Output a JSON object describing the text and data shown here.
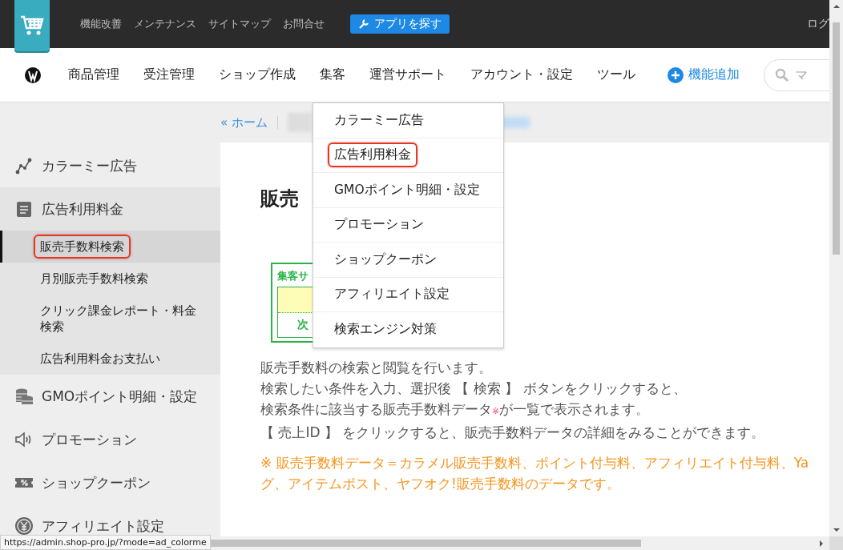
{
  "top_bar": {
    "links": [
      "機能改善",
      "メンテナンス",
      "サイトマップ",
      "お問合せ"
    ],
    "app_button": "アプリを探す",
    "login": "ログ"
  },
  "nav": {
    "items": [
      "商品管理",
      "受注管理",
      "ショップ作成",
      "集客",
      "運営サポート",
      "アカウント・設定",
      "ツール"
    ],
    "add_button": "機能追加",
    "search": {
      "placeholder": "マ"
    }
  },
  "breadcrumb": {
    "home": "« ホーム"
  },
  "sidebar": {
    "items": [
      {
        "label": "カラーミー広告",
        "kind": "chart"
      },
      {
        "label": "広告利用料金",
        "kind": "notepad",
        "children": [
          {
            "label": "販売手数料検索",
            "selected": true,
            "highlighted": true
          },
          {
            "label": "月別販売手数料検索",
            "selected": false,
            "highlighted": false
          },
          {
            "label": "クリック課金レポート・料金検索",
            "selected": false,
            "highlighted": false
          },
          {
            "label": "広告利用料金お支払い",
            "selected": false,
            "highlighted": false
          }
        ]
      },
      {
        "label": "GMOポイント明細・設定",
        "kind": "coins"
      },
      {
        "label": "プロモーション",
        "kind": "speaker"
      },
      {
        "label": "ショップクーポン",
        "kind": "coupon"
      },
      {
        "label": "アフィリエイト設定",
        "kind": "yen"
      }
    ]
  },
  "dropdown": {
    "items": [
      {
        "label": "カラーミー広告",
        "highlighted": false
      },
      {
        "label": "広告利用料金",
        "highlighted": true
      },
      {
        "label": "GMOポイント明細・設定",
        "highlighted": false
      },
      {
        "label": "プロモーション",
        "highlighted": false
      },
      {
        "label": "ショップクーポン",
        "highlighted": false
      },
      {
        "label": "アフィリエイト設定",
        "highlighted": false
      },
      {
        "label": "検索エンジン対策",
        "highlighted": false
      }
    ]
  },
  "content": {
    "title": "販売",
    "notice_box": {
      "title": "集客サ",
      "link": "次"
    },
    "description": [
      {
        "text": "販売手数料の検索と閲覧を行います。"
      },
      {
        "text": "検索したい条件を入力、選択後 【 検索 】 ボタンをクリックすると、"
      },
      {
        "text": "検索条件に該当する販売手数料データ",
        "mark": "※",
        "after": "が一覧で表示されます。"
      },
      {
        "text": "【 売上ID 】 をクリックすると、販売手数料データの詳細をみることができます。"
      }
    ],
    "note_lines": [
      "※ 販売手数料データ＝カラメル販売手数料、ポイント付与料、アフィリエイト付与料、Ya",
      "グ、アイテムポスト、ヤフオク!販売手数料のデータです。"
    ]
  },
  "status_url": "https://admin.shop-pro.jp/?mode=ad_colorme"
}
